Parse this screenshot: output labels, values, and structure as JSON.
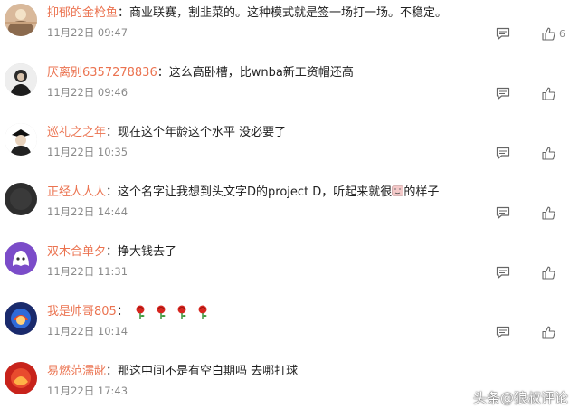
{
  "comments": [
    {
      "name": "抑郁的金枪鱼",
      "text": "商业联赛，割韭菜的。这种模式就是签一场打一场。不稳定。",
      "time": "11月22日 09:47",
      "likes": "6"
    },
    {
      "name": "厌离别6357278836",
      "text": "这么高卧槽，比wnba新工资帽还高",
      "time": "11月22日 09:46",
      "likes": ""
    },
    {
      "name": "巡礼之之年",
      "text": "现在这个年龄这个水平 没必要了",
      "time": "11月22日 10:35",
      "likes": ""
    },
    {
      "name": "正经人人人",
      "text_before": "这个名字让我想到头文字D的project D，听起来就很",
      "text_after": "的样子",
      "time": "11月22日 14:44",
      "likes": ""
    },
    {
      "name": "双木合单夕",
      "text": "挣大钱去了",
      "time": "11月22日 11:31",
      "likes": ""
    },
    {
      "name": "我是帅哥805",
      "time": "11月22日 10:14",
      "likes": ""
    },
    {
      "name": "易燃范濡龀",
      "text": "那这中间不是有空白期吗 去哪打球",
      "time": "11月22日 17:43",
      "likes": ""
    }
  ],
  "separator": "：",
  "watermark": "头条@狼叔评论",
  "icons": {
    "reply": "comment-icon",
    "like": "thumbs-up-icon",
    "rose": "rose-emoji-icon",
    "inline_emoji": "embarrassed-emoji-icon"
  },
  "colors": {
    "name": "#eb7350",
    "text": "#222222",
    "time": "#8a8a8a"
  }
}
